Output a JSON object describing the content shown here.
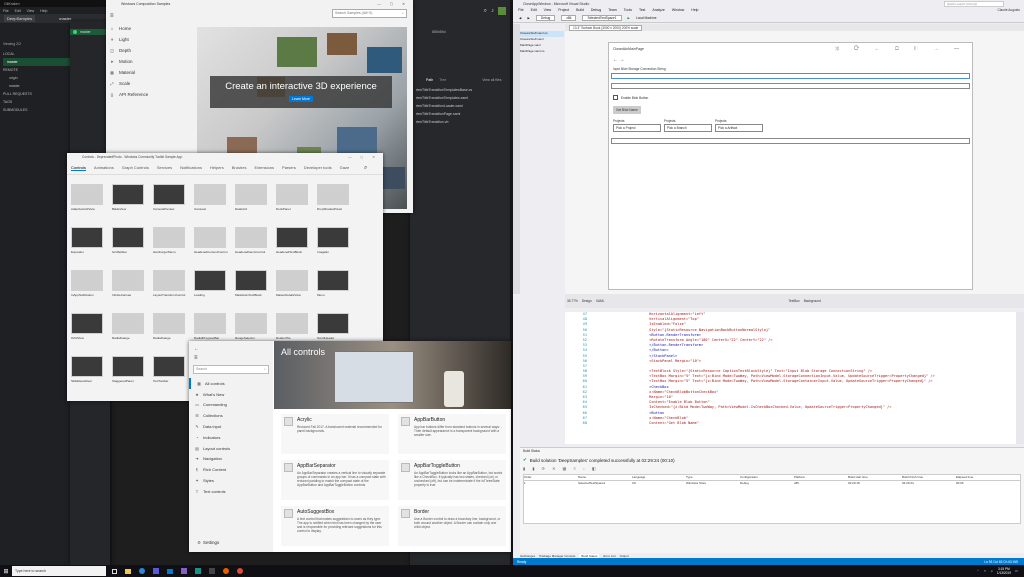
{
  "git": {
    "title": "GitKraken",
    "menu": [
      "File",
      "Edit",
      "View",
      "Help"
    ],
    "tab": "DeepSamples",
    "branch_button": "master",
    "viewing": "Viewing 2/2",
    "show_all": "Show All",
    "sections": [
      {
        "label": "LOCAL",
        "count": "1/1"
      },
      {
        "label": "master",
        "count": ""
      },
      {
        "label": "REMOTE",
        "count": "1/1"
      },
      {
        "label": "origin",
        "count": ""
      },
      {
        "label": "master",
        "count": ""
      },
      {
        "label": "PULL REQUESTS",
        "count": "0"
      },
      {
        "label": "TAGS",
        "count": "0/0"
      },
      {
        "label": "SUBMODULES",
        "count": "0"
      }
    ],
    "commit_label": "master",
    "files": [
      "rtenTitleTransitionTemplatesBase.cs",
      "rtenTitleTransitionTemplates.xaml",
      "rtenTitleTransitionLoader.xaml",
      "rtenTitleTransitionPage.xaml",
      "rtenTitleTransition.vb"
    ],
    "stage_path": "StageFile",
    "tabs": [
      "Path",
      "Tree"
    ],
    "view_all": "View all files",
    "hash": "885b89d"
  },
  "comp": {
    "title": "Windows Composition Samples",
    "search_placeholder": "Search Samples (Alt+S)",
    "nav": [
      {
        "icon": "home-icon",
        "glyph": "⌂",
        "label": "Home"
      },
      {
        "icon": "light-icon",
        "glyph": "☀",
        "label": "Light"
      },
      {
        "icon": "depth-icon",
        "glyph": "◫",
        "label": "Depth"
      },
      {
        "icon": "motion-icon",
        "glyph": "➤",
        "label": "Motion"
      },
      {
        "icon": "material-icon",
        "glyph": "▦",
        "label": "Material"
      },
      {
        "icon": "scale-icon",
        "glyph": "⤢",
        "label": "Scale"
      },
      {
        "icon": "api-icon",
        "glyph": "{}",
        "label": "API Reference"
      }
    ],
    "hero_title": "Create an interactive 3D experience",
    "hero_button": "Learn More"
  },
  "toolkit": {
    "title": "Controls - DeprecatedPhoto - Windows Community Toolkit Sample App",
    "tabs": [
      "Controls",
      "Animations",
      "Graph Controls",
      "Services",
      "Notifications",
      "Helpers",
      "Brushes",
      "Extensions",
      "Parsers",
      "Developer tools",
      "Gaze"
    ],
    "tiles": [
      "AdaptiveGridView",
      "BladeView",
      "CameraPreview",
      "Carousel",
      "DataGrid",
      "DockPanel",
      "DropShadowPanel",
      "Expander",
      "GridSplitter",
      "HamburgerMenu",
      "HeaderedContentControl",
      "HeaderedItemsControl",
      "HeaderedTextBlock",
      "ImageEx",
      "InAppNotification",
      "InfiniteCanvas",
      "LayoutTransformControl",
      "Loading",
      "MarkdownTextBlock",
      "MasterDetailsView",
      "Menu",
      "OrbitView",
      "RadialGauge",
      "RadialGauge",
      "RadialProgressBar",
      "RangeSelector",
      "RotatorTile",
      "ScrollHeader",
      "SlidableListItem",
      "StaggeredPanel",
      "TextToolbar"
    ]
  },
  "gallery": {
    "back": "←",
    "header": "All controls",
    "search_placeholder": "Search",
    "nav": [
      {
        "icon": "all-controls-icon",
        "glyph": "▦",
        "label": "All controls"
      },
      {
        "icon": "whats-new-icon",
        "glyph": "★",
        "label": "What's New"
      },
      {
        "icon": "commanding-icon",
        "glyph": "▭",
        "label": "Commanding"
      },
      {
        "icon": "collections-icon",
        "glyph": "☰",
        "label": "Collections"
      },
      {
        "icon": "data-input-icon",
        "glyph": "✎",
        "label": "Data input"
      },
      {
        "icon": "indicators-icon",
        "glyph": "◔",
        "label": "Indicators"
      },
      {
        "icon": "layout-icon",
        "glyph": "▤",
        "label": "Layout controls"
      },
      {
        "icon": "navigation-icon",
        "glyph": "➜",
        "label": "Navigation"
      },
      {
        "icon": "rich-content-icon",
        "glyph": "¶",
        "label": "Rich Content"
      },
      {
        "icon": "styles-icon",
        "glyph": "✦",
        "label": "Styles"
      },
      {
        "icon": "text-controls-icon",
        "glyph": "T",
        "label": "Text controls"
      }
    ],
    "settings": "Settings",
    "cards": [
      {
        "title": "Acrylic",
        "desc": "Reduced Fall 2017: A translucent material recommended for panel backgrounds."
      },
      {
        "title": "AppBarButton",
        "desc": "App bar buttons differ from standard buttons in several ways: - Their default appearance is a transparent background with a smaller size."
      },
      {
        "title": "AppBarSeparator",
        "desc": "An AppBarSeparator creates a vertical line to visually separate groups of commands in an app bar. It has a compact state with reduced padding to match the compact state of the AppBarButton and AppBarToggleButton controls."
      },
      {
        "title": "AppBarToggleButton",
        "desc": "An AppBarToggleButton looks like an AppBarButton, but works like a CheckBox. It typically has two states, checked (on) or unchecked (off), but can be indeterminate if the IsThreeState property is true."
      },
      {
        "title": "AutoSuggestBox",
        "desc": "A text control that makes suggestions to users as they type. The app is notified when text has been changed by the user and is responsible for providing relevant suggestions for this control to display."
      },
      {
        "title": "Border",
        "desc": "Use a Border control to draw a boundary line, background, or both around another object. A Border can contain only one child object."
      },
      {
        "title": "Button",
        "desc": ""
      },
      {
        "title": "CalendarDatePicker",
        "desc": ""
      }
    ]
  },
  "vs": {
    "title": "CloseAppWindow - Microsoft Visual Studio",
    "menu": [
      "File",
      "Edit",
      "View",
      "Project",
      "Build",
      "Debug",
      "Team",
      "Tools",
      "Test",
      "Analyze",
      "Window",
      "Help"
    ],
    "toolbar": [
      "Debug",
      "x86",
      "SelectedTestSpace1",
      "Local Machine"
    ],
    "search": "Quick Launch (Ctrl+Q)",
    "user": "Claude Augusto",
    "sol_tabs": [
      "ClosureStuff.xaml.cs",
      "ClosureStuff.xaml",
      "MainPage.xaml",
      "MainPage.xaml.cs"
    ],
    "designer_title": "ClosedAnMainPage",
    "designer_dropdown": "13.3\" Surface Book (3000 x 2000) 200% scale",
    "caption": "Input Blob Storage Connection String",
    "checkbox_label": "Enable Blob Button",
    "get_button": "Get Blob Name",
    "combos": [
      {
        "label": "Projects",
        "value": "Pick a Project"
      },
      {
        "label": "Projects",
        "value": "Pick a Branch"
      },
      {
        "label": "Projects",
        "value": "Pick a Artifact"
      }
    ],
    "zoom": "35.77%",
    "split_labels": [
      "Design",
      "XAML"
    ],
    "breadcrumb": "TextBox",
    "breadcrumb2": "Background",
    "code_start": 47,
    "code": [
      "                HorizontalAlignment=\"Left\"",
      "                VerticalAlignment=\"Top\"",
      "                IsEnabled=\"False\"",
      "                Style=\"{StaticResource NavigationBackButtonNormalStyle}\"",
      "            <Button.RenderTransform>",
      "                <RotateTransform Angle=\"180\" CenterX=\"22\" CenterY=\"22\" />",
      "            </Button.RenderTransform>",
      "        </Button>",
      "    </StackPanel>",
      "    <StackPanel Margin=\"10\">",
      "",
      "        <TextBlock Style=\"{StaticResource CaptionTextBlockStyle}\" Text=\"Input Blob Storage ConnectionString\" />",
      "        <TextBox Margin=\"5\" Text=\"{x:Bind Mode=TwoWay, Path=ViewModel.StorageConnectionInput.Value, UpdateSourceTrigger=PropertyChanged}\" />",
      "        <TextBox Margin=\"5\" Text=\"{x:Bind Mode=TwoWay, Path=ViewModel.StorageContainerInput.Value, UpdateSourceTrigger=PropertyChanged}\" />",
      "        <CheckBox",
      "            x:Name=\"CheckBlobButtonCheckBox\"",
      "            Margin=\"10\"",
      "            Content=\"Enable Blob Button\"",
      "            IsChecked=\"{x:Bind Mode=TwoWay, Path=ViewModel.IsCheckBoxChecked.Value, UpdateSourceTrigger=PropertyChanged}\" />",
      "        <Button",
      "            x:Name=\"CheckBlob\"",
      "            Content=\"Get Blob Name\""
    ],
    "output_title": "Build Status",
    "build_msg": "Build solution 'DeepSamples' completed successfully at 02:29:24 (00:10)",
    "build_cols": [
      "Order",
      "Name",
      "Language",
      "Type",
      "Configuration",
      "Platform",
      "Build start time",
      "Build finish time",
      "Elapsed time"
    ],
    "build_row": [
      "1",
      "SelectedTestSpace1",
      "C#",
      "Windows Store",
      "Debug",
      "x86",
      "02:29:18",
      "02:29:24",
      "00:06"
    ],
    "bottom_tabs": [
      "Gitchanges",
      "Package Manager Console",
      "Build Status",
      "Error List",
      "Output"
    ],
    "status": "Ready",
    "status_right": "Ln 93    Col 63    Ch 63    INS"
  },
  "taskbar": {
    "search": "Type here to search",
    "time": "3:15 PM",
    "date": "1/13/2019"
  }
}
